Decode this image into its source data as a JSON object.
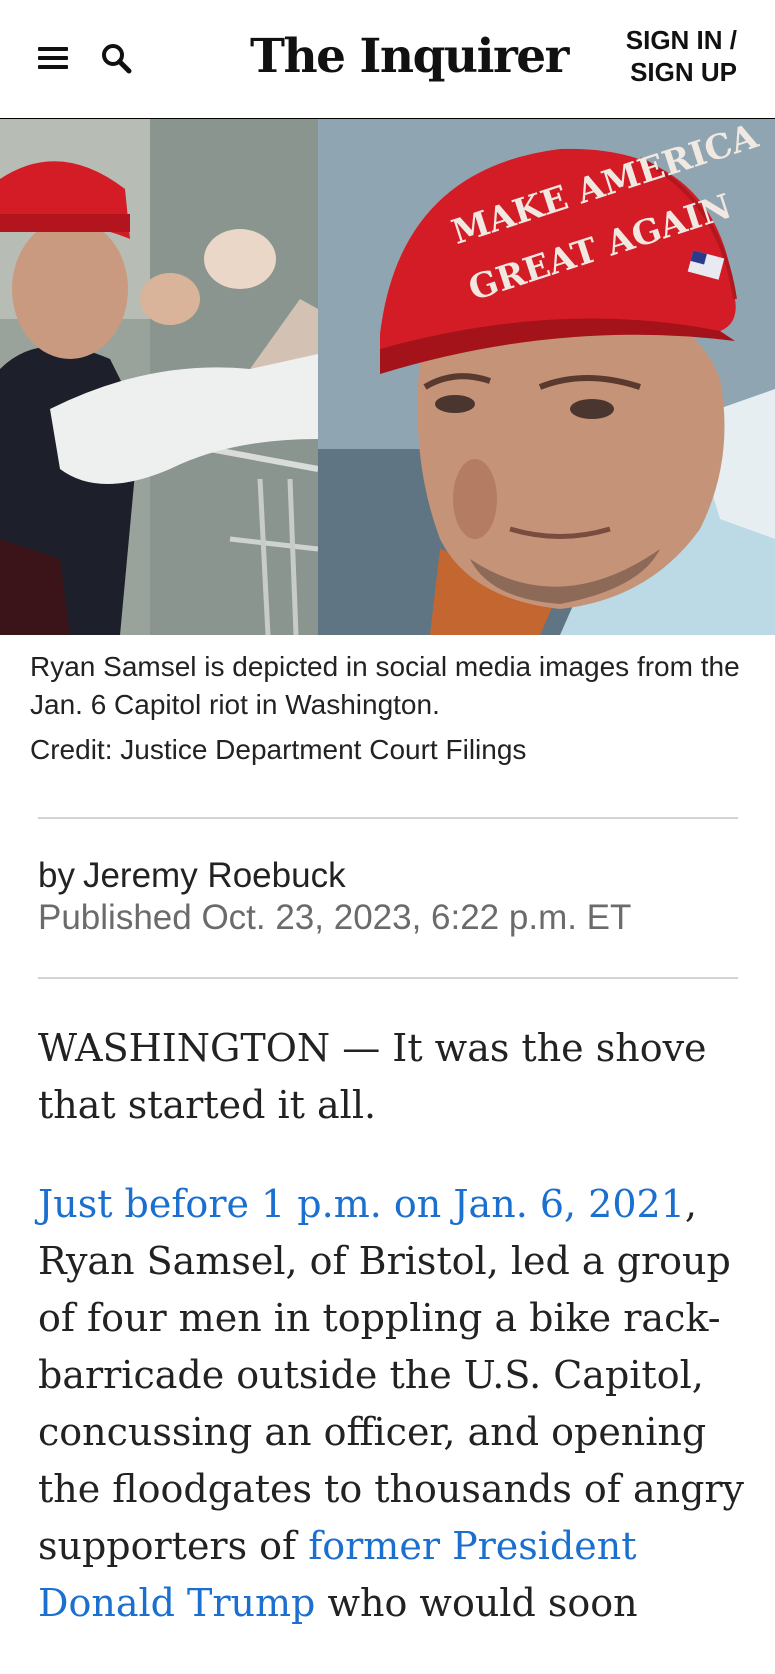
{
  "header": {
    "menu_icon": "hamburger-menu-icon",
    "search_icon": "search-icon",
    "logo_text": "The Inquirer",
    "sign_in_line1": "SIGN IN /",
    "sign_in_line2": "SIGN UP"
  },
  "hero": {
    "hat_text_line1": "MAKE AMERICA",
    "hat_text_line2": "GREAT AGAIN",
    "caption": "Ryan Samsel is depicted in social media images from the Jan. 6 Capitol riot in Washington.",
    "credit": "Credit: Justice Department Court Filings"
  },
  "byline": {
    "prefix": "by",
    "author": "Jeremy Roebuck",
    "published": "Published Oct. 23, 2023, 6:22 p.m. ET"
  },
  "article": {
    "p1": "WASHINGTON — It was the shove that started it all.",
    "p2_link1": "Just before 1 p.m. on Jan. 6, 2021",
    "p2_text1": ", Ryan Samsel, of Bristol, led a group of four men in toppling a bike rack-barricade outside the U.S. Capitol, concussing an officer, and opening the floodgates to thousands of angry supporters of ",
    "p2_link2": "former President Donald Trump",
    "p2_text2": " who would soon"
  },
  "colors": {
    "link": "#1a6fcf",
    "text": "#222222",
    "meta": "#6b6b6b",
    "rule": "#d4d4d4",
    "hat_red": "#d41c26"
  }
}
